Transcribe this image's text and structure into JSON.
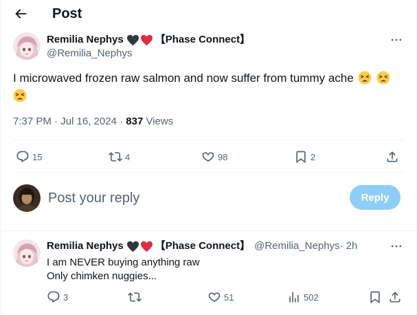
{
  "header": {
    "title": "Post"
  },
  "post": {
    "author": {
      "display_name": "Remilia Nephys",
      "emoji": [
        "black-heart",
        "red-heart"
      ],
      "affiliation": "【Phase Connect】",
      "handle": "@Remilia_Nephys"
    },
    "text": "I microwaved frozen raw salmon and now suffer from tummy ache",
    "text_emoji_count": 3,
    "time": "7:37 PM · Jul 16, 2024 · ",
    "views_count": "837",
    "views_label": " Views",
    "stats": {
      "replies": "15",
      "reposts": "4",
      "likes": "98",
      "bookmarks": "2"
    }
  },
  "composer": {
    "placeholder": "Post your reply",
    "reply_label": "Reply"
  },
  "reply": {
    "author": {
      "display_name": "Remilia Nephys",
      "affiliation": "【Phase Connect】",
      "handle": "@Remilia_Nephys",
      "time": " · 2h"
    },
    "lines": [
      "I am NEVER buying anything raw",
      "Only chimken nuggies..."
    ],
    "stats": {
      "replies": "3",
      "reposts": "",
      "likes": "51",
      "views": "502"
    }
  },
  "colors": {
    "accent": "#1d9bf0",
    "reply_button": "#8ecdf8",
    "secondary_text": "#536471",
    "divider": "#eff3f4"
  },
  "icons": [
    "back-arrow-icon",
    "more-icon",
    "reply-icon",
    "repost-icon",
    "like-icon",
    "bookmark-icon",
    "share-icon",
    "views-icon"
  ]
}
